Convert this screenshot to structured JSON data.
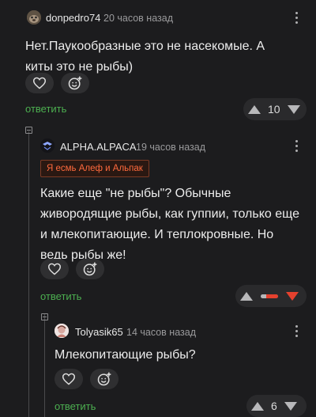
{
  "comments": [
    {
      "username": "donpedro74",
      "time": "20 часов назад",
      "text": "Нет.Паукообразные это не насекомые. А киты это не рыбы)",
      "reply_label": "ответить",
      "rating": "10"
    },
    {
      "username": "ALPHA.ALPACA",
      "time": "19 часов назад",
      "badge": "Я есмь Алеф и Альпак",
      "text": "Какие еще \"не рыбы\"? Обычные живородящие рыбы, как гуппии, только еще и млекопитающие. И теплокровные. Но ведь рыбы же!",
      "reply_label": "ответить",
      "rating_bar": {
        "positive_fraction": 0.3,
        "negative_fraction": 0.7
      }
    },
    {
      "username": "Tolyasik65",
      "time": "14 часов назад",
      "text": "Млекопитающие рыбы?",
      "reply_label": "ответить",
      "rating": "6"
    }
  ],
  "colors": {
    "reply": "#4caf50",
    "downvote_active": "#e5412e",
    "badge": "#ff6a3d"
  },
  "icons": [
    "heart-icon",
    "emoji-add-icon",
    "upvote-icon",
    "downvote-icon",
    "more-icon",
    "collapse-icon"
  ]
}
